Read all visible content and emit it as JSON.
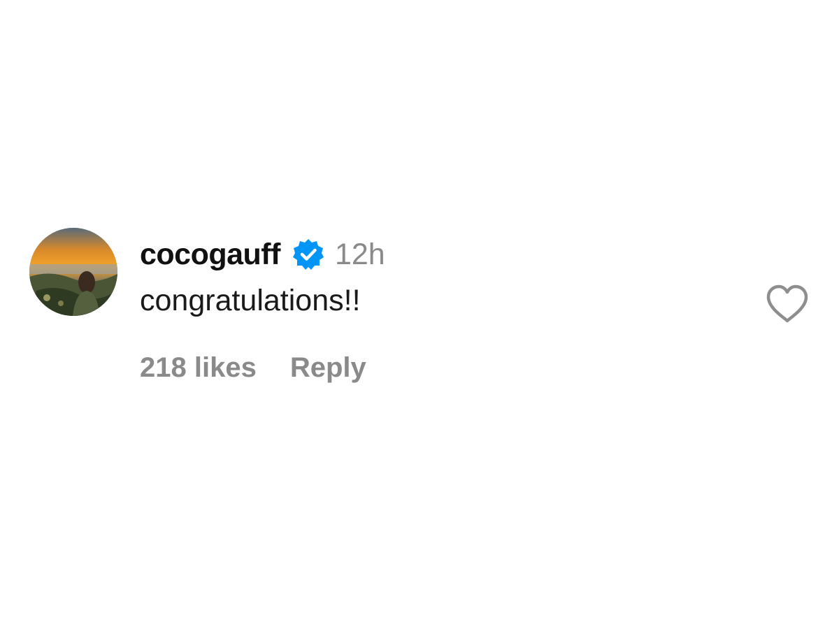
{
  "comment": {
    "username": "cocogauff",
    "verified": true,
    "verified_icon": "verified-badge-icon",
    "timestamp": "12h",
    "text": "congratulations!!",
    "likes_label": "218 likes",
    "reply_label": "Reply",
    "like_icon": "heart-outline-icon",
    "avatar_icon": "profile-photo"
  },
  "colors": {
    "username": "#111111",
    "muted": "#8a8a8a",
    "verified_blue": "#0095f6",
    "heart_stroke": "#8e8e8e"
  }
}
